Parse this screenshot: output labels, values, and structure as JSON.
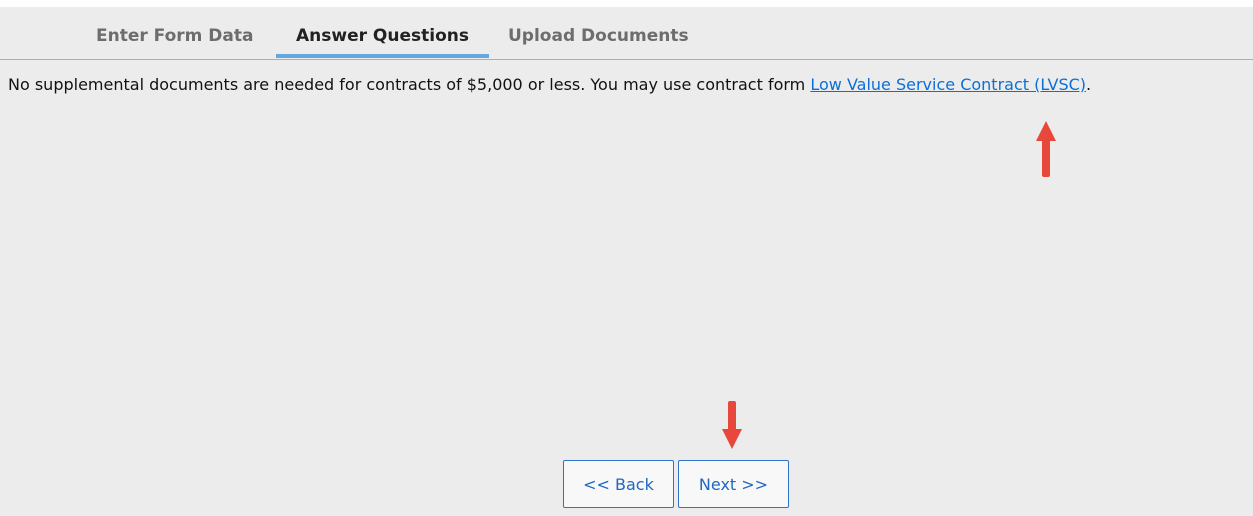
{
  "tabs": [
    {
      "label": "Enter Form Data",
      "active": false
    },
    {
      "label": "Answer Questions",
      "active": true
    },
    {
      "label": "Upload Documents",
      "active": false
    }
  ],
  "message": {
    "text": "No supplemental documents are needed for contracts of $5,000 or less. You may use contract form ",
    "link_text": "Low Value Service Contract (LVSC)",
    "trailing": "."
  },
  "buttons": {
    "back_label": "<< Back",
    "next_label": "Next >>"
  },
  "colors": {
    "panel_background": "#ececec",
    "active_tab_underline": "#66a7dd",
    "link": "#0b6fd8",
    "button_border": "#2f73c9",
    "annotation_arrow": "#e8473b"
  },
  "annotations": [
    {
      "icon": "arrow-up-icon",
      "points_to": "link"
    },
    {
      "icon": "arrow-down-icon",
      "points_to": "next-button"
    }
  ]
}
